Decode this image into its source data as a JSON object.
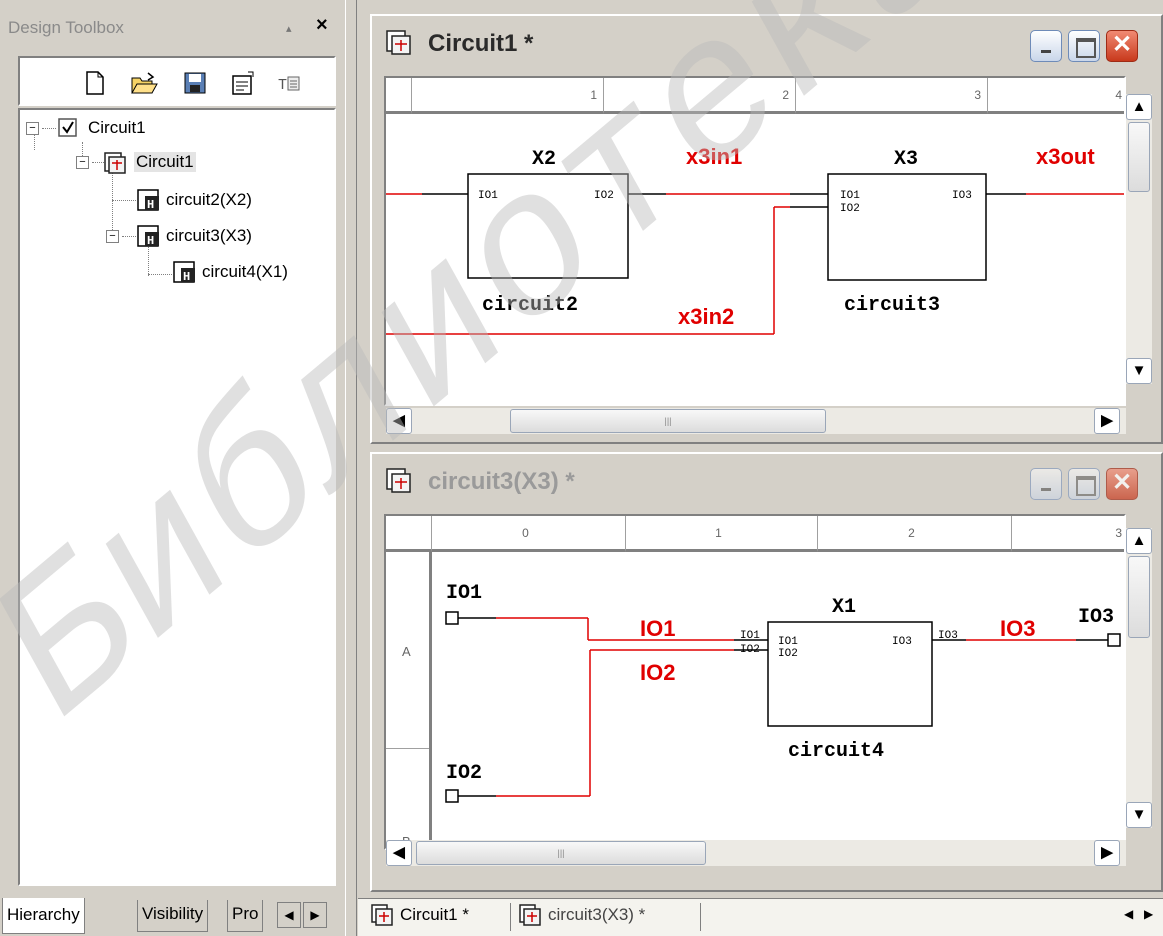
{
  "toolbox": {
    "title": "Design Toolbox",
    "pin_glyph": "▴",
    "close_glyph": "×",
    "toolbar_icons": [
      "new-document-icon",
      "open-folder-icon",
      "save-icon",
      "properties-icon",
      "text-edit-icon"
    ],
    "tree": [
      {
        "label": "Circuit1",
        "icon": "checkbox-icon",
        "expander": "−"
      },
      {
        "label": "Circuit1",
        "icon": "schematic-icon",
        "expander": "−",
        "selected": true
      },
      {
        "label": "circuit2(X2)",
        "icon": "hdl-icon"
      },
      {
        "label": "circuit3(X3)",
        "icon": "hdl-icon",
        "expander": "−"
      },
      {
        "label": "circuit4(X1)",
        "icon": "hdl-icon"
      }
    ],
    "tabs": [
      "Hierarchy",
      "Visibility",
      "Pro"
    ],
    "tab_left": "◀",
    "tab_right": "▶"
  },
  "window1": {
    "title": "Circuit1 *",
    "close_glyph": "✕",
    "ruler": [
      "1",
      "2",
      "3",
      "4"
    ],
    "hthumb": "|||",
    "sch": {
      "block_x2_name": "X2",
      "block_x2_type": "circuit2",
      "block_x3_name": "X3",
      "block_x3_type": "circuit3",
      "pin_io1": "IO1",
      "pin_io2": "IO2",
      "pin_io3": "IO3",
      "net_x3in1": "x3in1",
      "net_x3in2": "x3in2",
      "net_x3out": "x3out"
    }
  },
  "window2": {
    "title": "circuit3(X3) *",
    "close_glyph": "✕",
    "ruler": [
      "0",
      "1",
      "2",
      "3"
    ],
    "row_labels": [
      "A",
      "B"
    ],
    "hthumb": "|||",
    "sch": {
      "port_io1": "IO1",
      "port_io2": "IO2",
      "port_io3": "IO3",
      "net_io1": "IO1",
      "net_io2": "IO2",
      "net_io3": "IO3",
      "block_x1_name": "X1",
      "block_x1_type": "circuit4",
      "pin_io1": "IO1",
      "pin_io2": "IO2",
      "pin_io3": "IO3"
    }
  },
  "doc_tabs": [
    "Circuit1 *",
    "circuit3(X3) *"
  ],
  "doc_nav_left": "◀",
  "doc_nav_right": "▶",
  "scroll_glyphs": {
    "up": "▲",
    "down": "▼",
    "left": "◀",
    "right": "▶"
  },
  "watermark": "Библиотека",
  "colors": {
    "net": "#e00000",
    "wire": "#000000",
    "watermark": "#c8c8c8"
  }
}
